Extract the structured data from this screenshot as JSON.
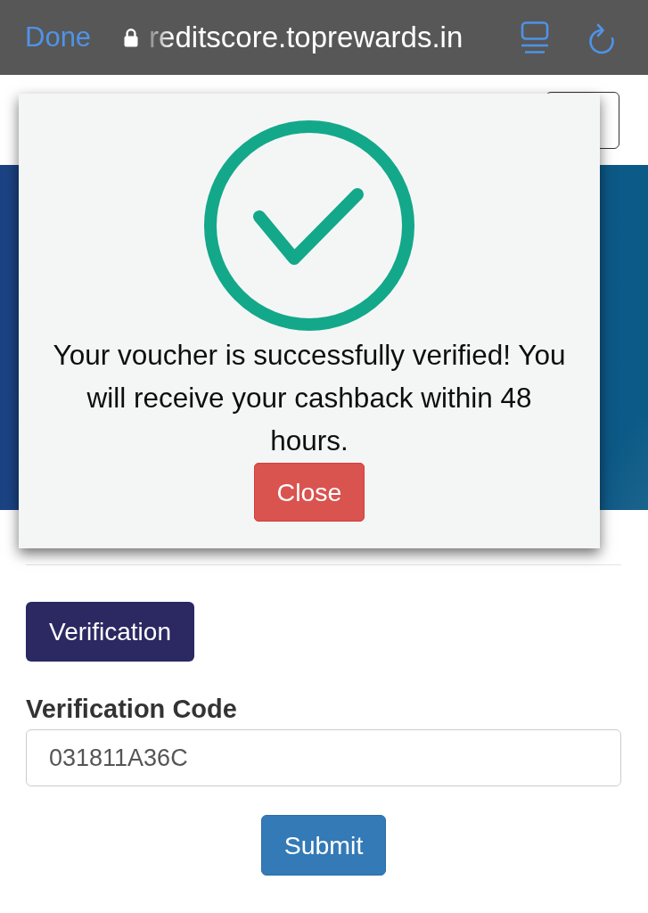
{
  "browser_bar": {
    "done_label": "Done",
    "url": "reditscore.toprewards.in"
  },
  "modal": {
    "message": "Your voucher is successfully verified! You will receive your cashback within 48 hours.",
    "close_button": "Close"
  },
  "form": {
    "section_button": "Verification",
    "field_label": "Verification Code",
    "code_value": "031811A36C",
    "submit_button": "Submit"
  }
}
